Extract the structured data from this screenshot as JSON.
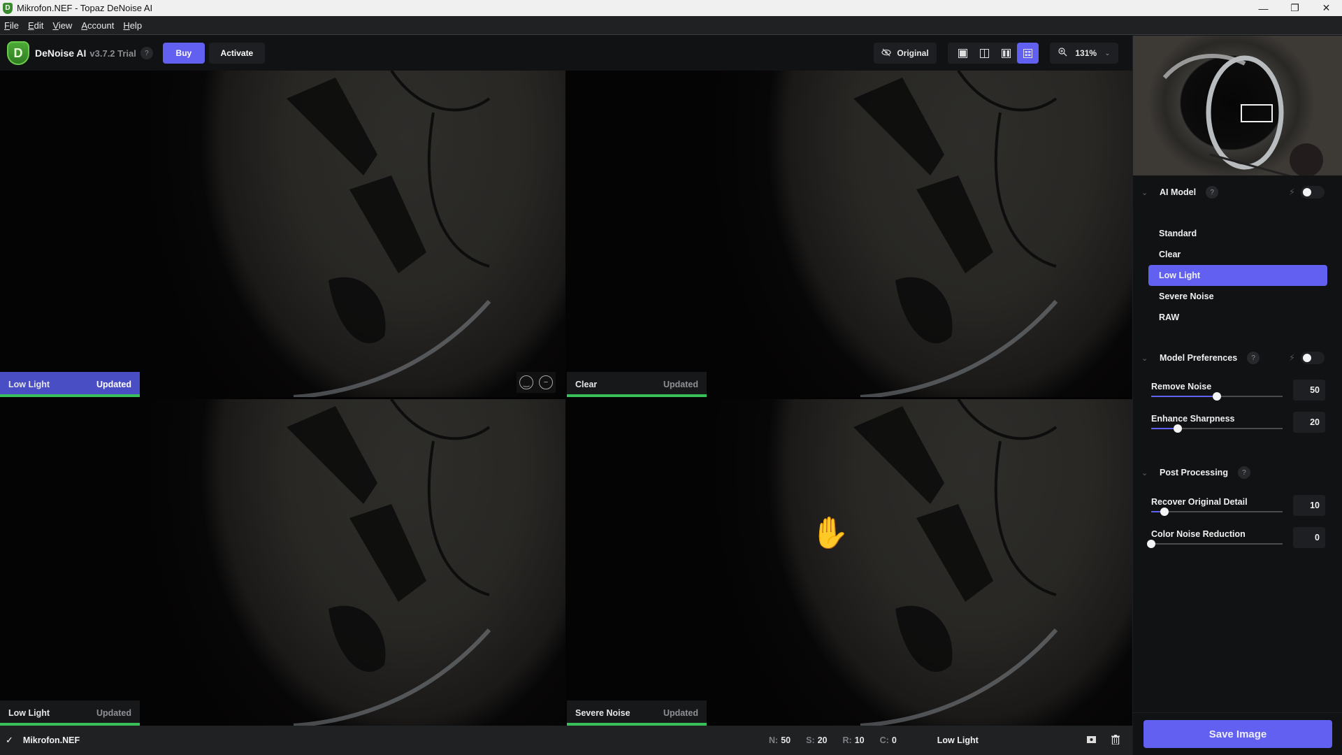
{
  "window": {
    "title": "Mikrofon.NEF - Topaz DeNoise AI",
    "controls": [
      "minimize",
      "restore",
      "close"
    ]
  },
  "menu": [
    "File",
    "Edit",
    "View",
    "Account",
    "Help"
  ],
  "toolbar": {
    "app_name": "DeNoise AI",
    "version": "v3.7.2 Trial",
    "help": "?",
    "buy_label": "Buy",
    "activate_label": "Activate",
    "original_label": "Original",
    "view_modes": [
      "single-view",
      "split-view",
      "side-by-side-view",
      "comparison-grid-view"
    ],
    "active_view_mode": "comparison-grid-view",
    "zoom_level": "131%"
  },
  "panes": [
    {
      "model": "Low Light",
      "status": "Updated",
      "selected": true,
      "progress": 100
    },
    {
      "model": "Clear",
      "status": "Updated",
      "selected": false,
      "progress": 100
    },
    {
      "model": "Low Light",
      "status": "Updated",
      "selected": false,
      "progress": 100
    },
    {
      "model": "Severe Noise",
      "status": "Updated",
      "selected": false,
      "progress": 100
    }
  ],
  "bottom_bar": {
    "check": "✓",
    "filename": "Mikrofon.NEF",
    "stats": [
      {
        "key": "N:",
        "value": "50"
      },
      {
        "key": "S:",
        "value": "20"
      },
      {
        "key": "R:",
        "value": "10"
      },
      {
        "key": "C:",
        "value": "0"
      }
    ],
    "model": "Low Light"
  },
  "sidebar": {
    "ai_model": {
      "title": "AI Model",
      "help": "?",
      "auto_enabled": false,
      "options": [
        "Standard",
        "Clear",
        "Low Light",
        "Severe Noise",
        "RAW"
      ],
      "selected": "Low Light"
    },
    "model_preferences": {
      "title": "Model Preferences",
      "help": "?",
      "auto_enabled": false,
      "sliders": [
        {
          "label": "Remove Noise",
          "value": 50,
          "max": 100
        },
        {
          "label": "Enhance Sharpness",
          "value": 20,
          "max": 100
        }
      ]
    },
    "post_processing": {
      "title": "Post Processing",
      "help": "?",
      "sliders": [
        {
          "label": "Recover Original Detail",
          "value": 10,
          "max": 100
        },
        {
          "label": "Color Noise Reduction",
          "value": 0,
          "max": 100
        }
      ]
    },
    "save_label": "Save Image"
  },
  "colors": {
    "accent": "#6160f0",
    "selected_pane": "#4a4ec4",
    "progress_green": "#39c05a",
    "background": "#111214"
  }
}
